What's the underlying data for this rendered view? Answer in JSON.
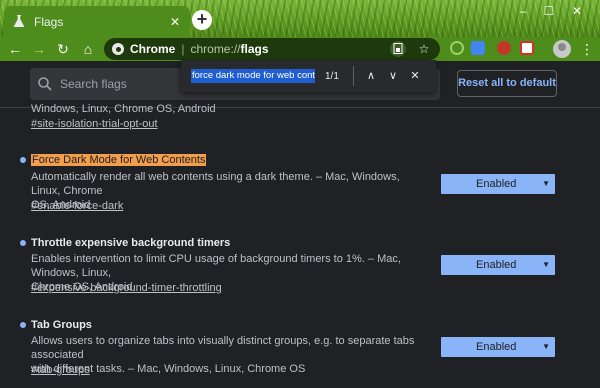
{
  "tab": {
    "title": "Flags",
    "close": "✕"
  },
  "window": {
    "minimize": "–",
    "maximize": "☐",
    "close": "✕"
  },
  "toolbar": {
    "back": "←",
    "forward": "→",
    "reload": "↻",
    "home": "⌂",
    "omnibox": {
      "site_label": "Chrome",
      "scheme": "chrome://",
      "path": "flags"
    },
    "bookmark_star": "☆",
    "menu": "⋮"
  },
  "page": {
    "search_placeholder": "Search flags",
    "reset_label": "Reset all to default"
  },
  "findbar": {
    "query": "force dark mode for web conte",
    "count": "1/1",
    "prev": "∧",
    "next": "∨",
    "close": "✕"
  },
  "fragment": {
    "text": "Windows, Linux, Chrome OS, Android",
    "link": "#site-isolation-trial-opt-out"
  },
  "flags": [
    {
      "title": "Force Dark Mode for Web Contents",
      "description_lines": [
        "Automatically render all web contents using a dark theme. – Mac, Windows, Linux, Chrome",
        "OS, Android"
      ],
      "link": "#enable-force-dark",
      "value": "Enabled"
    },
    {
      "title": "Throttle expensive background timers",
      "description_lines": [
        "Enables intervention to limit CPU usage of background timers to 1%. – Mac, Windows, Linux,",
        "Chrome OS, Android"
      ],
      "link": "#expensive-background-timer-throttling",
      "value": "Enabled"
    },
    {
      "title": "Tab Groups",
      "description_lines": [
        "Allows users to organize tabs into visually distinct groups, e.g. to separate tabs associated",
        "with different tasks. – Mac, Windows, Linux, Chrome OS"
      ],
      "link": "#tab-groups",
      "value": "Enabled"
    }
  ],
  "select_arrow": "▼",
  "colors": {
    "accent": "#8ab4f8",
    "highlight": "#f29e4c",
    "frame": "#4e8c1c"
  }
}
